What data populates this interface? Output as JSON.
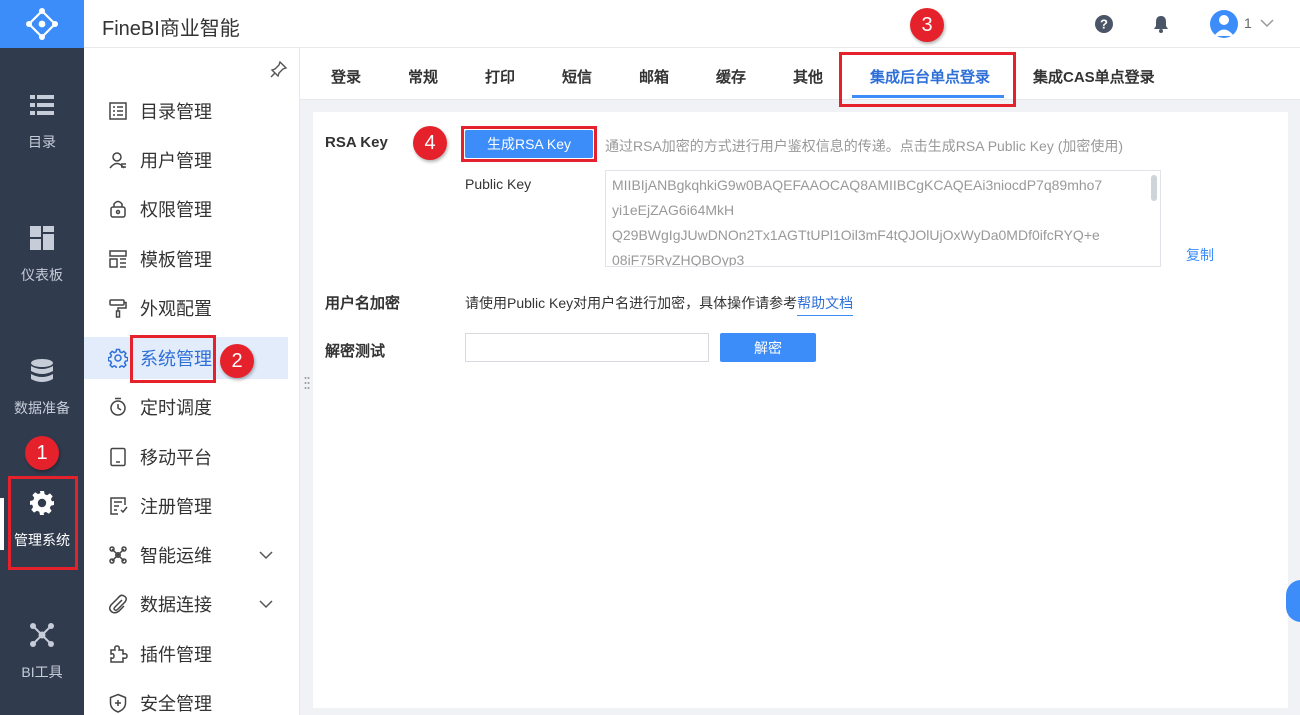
{
  "app": {
    "title": "FineBI商业智能"
  },
  "header": {
    "user_name": "1",
    "help_icon": "help-circle-icon",
    "bell_icon": "bell-icon"
  },
  "rail": {
    "items": [
      {
        "label": "目录",
        "icon": "list-icon"
      },
      {
        "label": "仪表板",
        "icon": "dashboard-grid-icon"
      },
      {
        "label": "数据准备",
        "icon": "database-icon"
      },
      {
        "label": "管理系统",
        "icon": "gear-icon"
      },
      {
        "label": "BI工具",
        "icon": "network-icon"
      }
    ]
  },
  "sidebar": {
    "items": [
      {
        "label": "目录管理"
      },
      {
        "label": "用户管理"
      },
      {
        "label": "权限管理"
      },
      {
        "label": "模板管理"
      },
      {
        "label": "外观配置"
      },
      {
        "label": "系统管理"
      },
      {
        "label": "定时调度"
      },
      {
        "label": "移动平台"
      },
      {
        "label": "注册管理"
      },
      {
        "label": "智能运维"
      },
      {
        "label": "数据连接"
      },
      {
        "label": "插件管理"
      },
      {
        "label": "安全管理"
      }
    ]
  },
  "tabs": [
    {
      "label": "登录"
    },
    {
      "label": "常规"
    },
    {
      "label": "打印"
    },
    {
      "label": "短信"
    },
    {
      "label": "邮箱"
    },
    {
      "label": "缓存"
    },
    {
      "label": "其他"
    },
    {
      "label": "集成后台单点登录"
    },
    {
      "label": "集成CAS单点登录"
    }
  ],
  "rsa": {
    "label": "RSA Key",
    "generate_button": "生成RSA Key",
    "hint": "通过RSA加密的方式进行用户鉴权信息的传递。点击生成RSA Public Key (加密使用)",
    "public_key_label": "Public Key",
    "public_key_lines": [
      "MIIBIjANBgkqhkiG9w0BAQEFAAOCAQ8AMIIBCgKCAQEAi3niocdP7q89mho7",
      "yi1eEjZAG6i64MkH",
      "Q29BWgIgJUwDNOn2Tx1AGTtUPl1Oil3mF4tQJOlUjOxWyDa0MDf0ifcRYQ+e",
      "08iF75RyZHQBOyp3"
    ],
    "copy_label": "复制"
  },
  "username_encrypt": {
    "label": "用户名加密",
    "text": "请使用Public Key对用户名进行加密，具体操作请参考",
    "link": "帮助文档"
  },
  "decrypt": {
    "label": "解密测试",
    "input_value": "",
    "button": "解密"
  },
  "annotations": {
    "step1": "1",
    "step2": "2",
    "step3": "3",
    "step4": "4"
  },
  "colors": {
    "accent": "#3c8dfa",
    "rail_bg": "#313b4e",
    "annotation_red": "#e5222b"
  }
}
